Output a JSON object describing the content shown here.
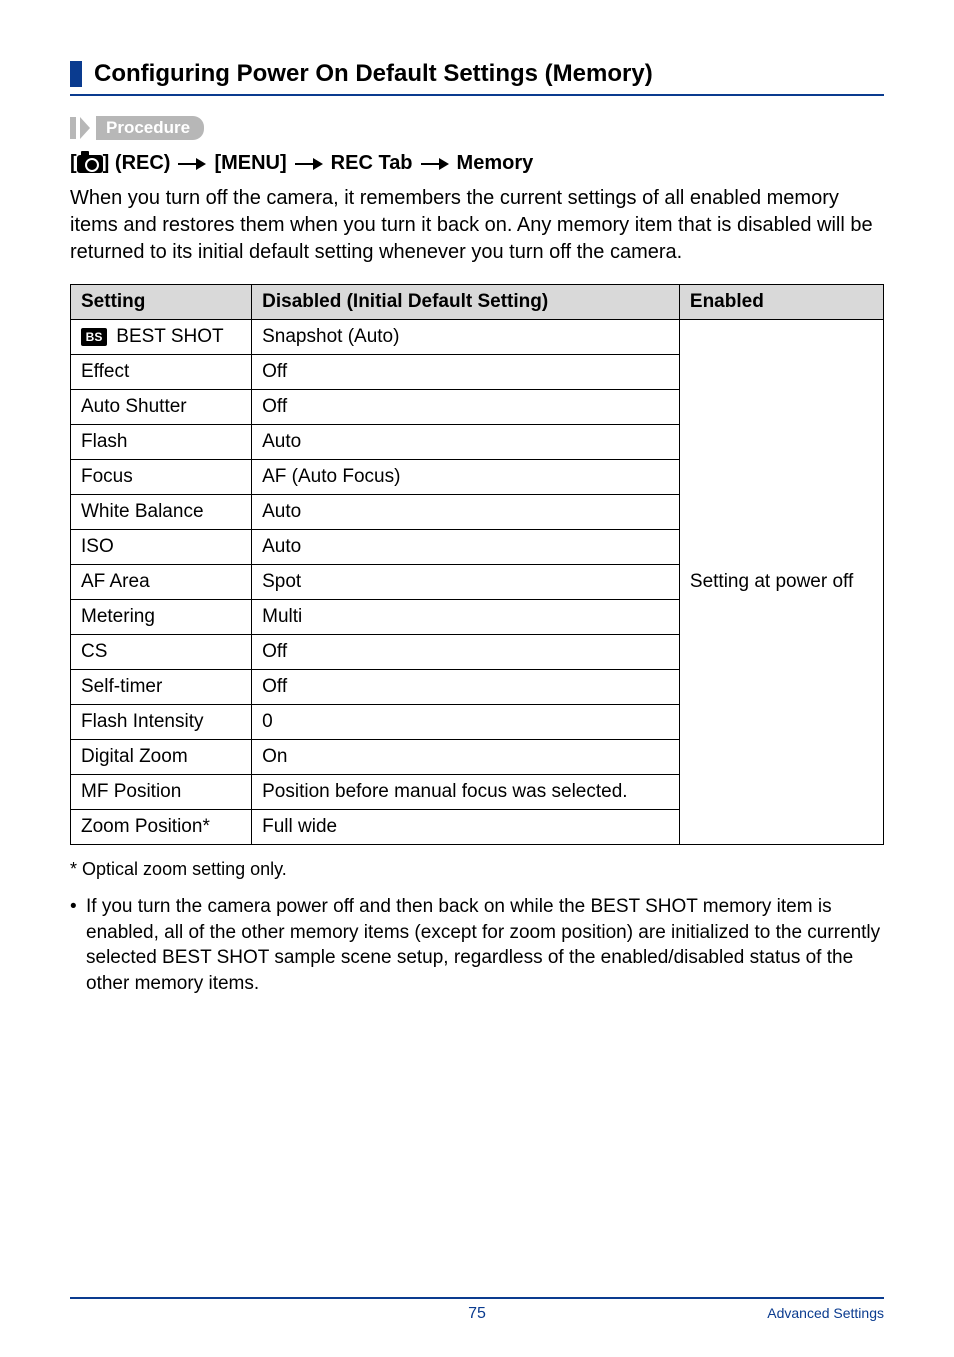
{
  "heading": "Configuring Power On Default Settings (Memory)",
  "procedure_label": "Procedure",
  "breadcrumb": {
    "prefix_open": "[",
    "prefix_close": "]",
    "rec": "(REC)",
    "menu": "[MENU]",
    "tab": "REC Tab",
    "memory": "Memory"
  },
  "intro": "When you turn off the camera, it remembers the current settings of all enabled memory items and restores them when you turn it back on. Any memory item that is disabled will be returned to its initial default setting whenever you turn off the camera.",
  "table": {
    "headers": {
      "setting": "Setting",
      "disabled": "Disabled (Initial Default Setting)",
      "enabled": "Enabled"
    },
    "rows": [
      {
        "setting": " BEST SHOT",
        "disabled": "Snapshot (Auto)",
        "icon": "bs"
      },
      {
        "setting": "Effect",
        "disabled": "Off"
      },
      {
        "setting": "Auto Shutter",
        "disabled": "Off"
      },
      {
        "setting": "Flash",
        "disabled": "Auto"
      },
      {
        "setting": "Focus",
        "disabled": "AF (Auto Focus)"
      },
      {
        "setting": "White Balance",
        "disabled": "Auto"
      },
      {
        "setting": "ISO",
        "disabled": "Auto"
      },
      {
        "setting": "AF Area",
        "disabled": "Spot"
      },
      {
        "setting": "Metering",
        "disabled": "Multi"
      },
      {
        "setting": "CS",
        "disabled": "Off"
      },
      {
        "setting": "Self-timer",
        "disabled": "Off"
      },
      {
        "setting": "Flash Intensity",
        "disabled": "0"
      },
      {
        "setting": "Digital Zoom",
        "disabled": "On"
      },
      {
        "setting": "MF Position",
        "disabled": "Position before manual focus was selected."
      },
      {
        "setting": "Zoom Position*",
        "disabled": "Full wide"
      }
    ],
    "enabled_text": "Setting at power off"
  },
  "footnote_marker": "*",
  "footnote_text": "Optical zoom setting only.",
  "bullet": "If you turn the camera power off and then back on while the BEST SHOT memory item is enabled, all of the other memory items (except for zoom position) are initialized to the currently selected BEST SHOT sample scene setup, regardless of the enabled/disabled status of the other memory items.",
  "footer": {
    "page": "75",
    "section": "Advanced Settings"
  },
  "chart_data": {
    "type": "table",
    "title": "Configuring Power On Default Settings (Memory)",
    "columns": [
      "Setting",
      "Disabled (Initial Default Setting)",
      "Enabled"
    ],
    "rows": [
      [
        "BS BEST SHOT",
        "Snapshot (Auto)",
        "Setting at power off"
      ],
      [
        "Effect",
        "Off",
        "Setting at power off"
      ],
      [
        "Auto Shutter",
        "Off",
        "Setting at power off"
      ],
      [
        "Flash",
        "Auto",
        "Setting at power off"
      ],
      [
        "Focus",
        "AF (Auto Focus)",
        "Setting at power off"
      ],
      [
        "White Balance",
        "Auto",
        "Setting at power off"
      ],
      [
        "ISO",
        "Auto",
        "Setting at power off"
      ],
      [
        "AF Area",
        "Spot",
        "Setting at power off"
      ],
      [
        "Metering",
        "Multi",
        "Setting at power off"
      ],
      [
        "CS",
        "Off",
        "Setting at power off"
      ],
      [
        "Self-timer",
        "Off",
        "Setting at power off"
      ],
      [
        "Flash Intensity",
        "0",
        "Setting at power off"
      ],
      [
        "Digital Zoom",
        "On",
        "Setting at power off"
      ],
      [
        "MF Position",
        "Position before manual focus was selected.",
        "Setting at power off"
      ],
      [
        "Zoom Position*",
        "Full wide",
        "Setting at power off"
      ]
    ]
  }
}
